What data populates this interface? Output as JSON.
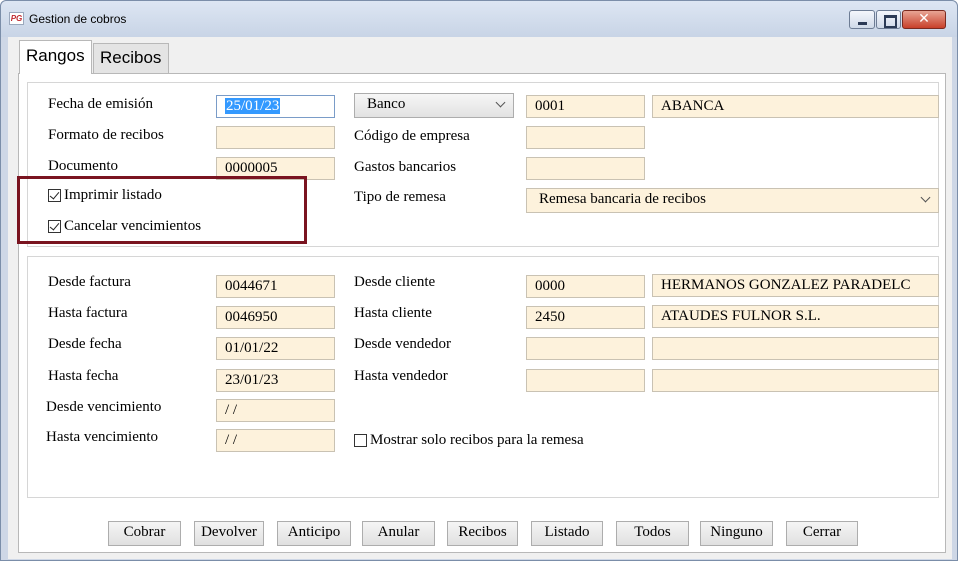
{
  "window": {
    "title": "Gestion de cobros",
    "icon_text": "PG",
    "close_glyph": "✕"
  },
  "tabs": {
    "rangos": "Rangos",
    "recibos": "Recibos"
  },
  "group1": {
    "fecha_emision_label": "Fecha de emisión",
    "fecha_emision_value": "25/01/23",
    "formato_recibos_label": "Formato de recibos",
    "formato_recibos_value": "",
    "documento_label": "Documento",
    "documento_value": "0000005",
    "imprimir_listado_label": "Imprimir listado",
    "imprimir_listado_checked": true,
    "cancelar_vencimientos_label": "Cancelar vencimientos",
    "cancelar_vencimientos_checked": true,
    "banco_select": "Banco",
    "banco_code": "0001",
    "banco_name": "ABANCA",
    "codigo_empresa_label": "Código de empresa",
    "codigo_empresa_value": "",
    "gastos_bancarios_label": "Gastos bancarios",
    "gastos_bancarios_value": "",
    "tipo_remesa_label": "Tipo de remesa",
    "tipo_remesa_value": "Remesa bancaria de recibos"
  },
  "group2": {
    "desde_factura_label": "Desde factura",
    "desde_factura_value": "0044671",
    "hasta_factura_label": "Hasta factura",
    "hasta_factura_value": "0046950",
    "desde_fecha_label": "Desde fecha",
    "desde_fecha_value": "01/01/22",
    "hasta_fecha_label": "Hasta fecha",
    "hasta_fecha_value": "23/01/23",
    "desde_vencimiento_label": "Desde vencimiento",
    "desde_vencimiento_value": " /  /",
    "hasta_vencimiento_label": "Hasta vencimiento",
    "hasta_vencimiento_value": " /  /",
    "desde_cliente_label": "Desde cliente",
    "desde_cliente_code": "0000",
    "desde_cliente_name": "HERMANOS GONZALEZ PARADELC",
    "hasta_cliente_label": "Hasta cliente",
    "hasta_cliente_code": "2450",
    "hasta_cliente_name": "ATAUDES FULNOR S.L.",
    "desde_vendedor_label": "Desde vendedor",
    "desde_vendedor_code": "",
    "desde_vendedor_name": "",
    "hasta_vendedor_label": "Hasta vendedor",
    "hasta_vendedor_code": "",
    "hasta_vendedor_name": "",
    "mostrar_solo_label": "Mostrar solo recibos para la remesa",
    "mostrar_solo_checked": false
  },
  "buttons": {
    "cobrar": "Cobrar",
    "devolver": "Devolver",
    "anticipo": "Anticipo",
    "anular": "Anular",
    "recibos": "Recibos",
    "listado": "Listado",
    "todos": "Todos",
    "ninguno": "Ninguno",
    "cerrar": "Cerrar"
  },
  "colors": {
    "field_bg": "#fdf2dc",
    "highlight_border": "#7a1420",
    "selection": "#3399ff"
  }
}
